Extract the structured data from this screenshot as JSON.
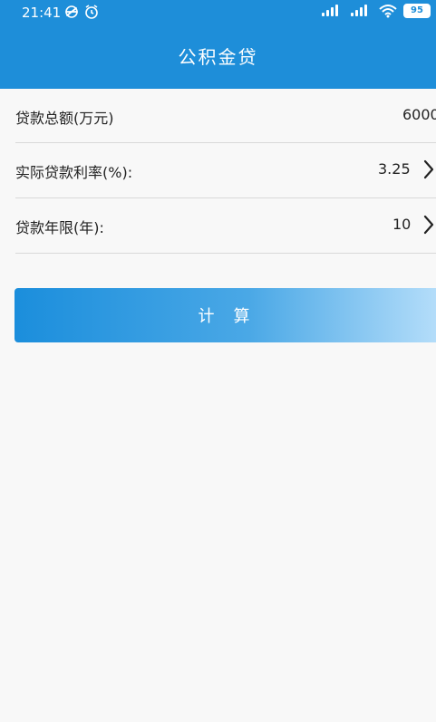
{
  "status_bar": {
    "time": "21:41",
    "battery": "95"
  },
  "header": {
    "title": "公积金贷"
  },
  "form": {
    "rows": [
      {
        "label": "贷款总额(万元)",
        "value": "6000"
      },
      {
        "label": "实际贷款利率(%):",
        "value": "3.25"
      },
      {
        "label": "贷款年限(年):",
        "value": "10"
      }
    ]
  },
  "calculate_button": {
    "label": "计 算"
  },
  "colors": {
    "header": "#1e8ed9",
    "background": "#f8f8f8",
    "button_start": "#1b8edc",
    "button_end": "#b6defa"
  }
}
